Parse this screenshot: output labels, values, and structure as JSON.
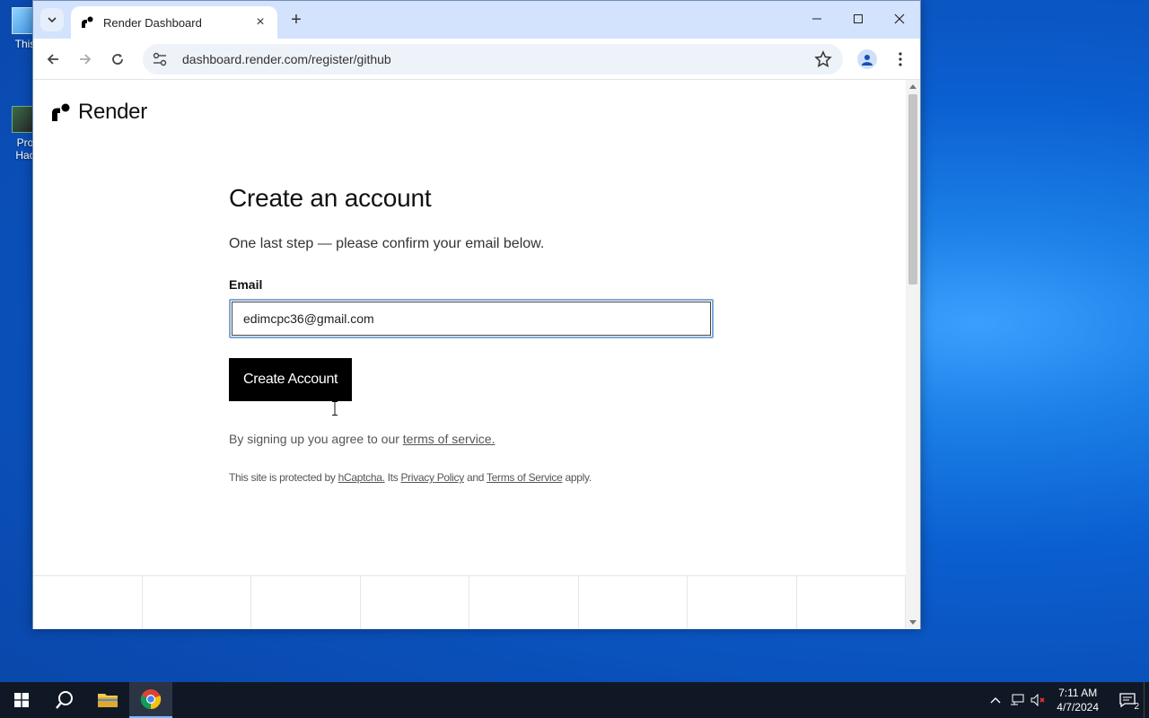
{
  "desktop": {
    "icons": [
      {
        "label": "This"
      },
      {
        "label": "Pro Hac"
      }
    ]
  },
  "browser": {
    "tab": {
      "title": "Render Dashboard"
    },
    "url": "dashboard.render.com/register/github"
  },
  "page": {
    "logo_text": "Render",
    "heading": "Create an account",
    "subtitle": "One last step — please confirm your email below.",
    "email_label": "Email",
    "email_value": "edimcpc36@gmail.com",
    "cta_label": "Create Account",
    "terms_prefix": "By signing up you agree to our ",
    "terms_link": "terms of service.",
    "captcha_prefix": "This site is protected by ",
    "captcha_link": "hCaptcha.",
    "captcha_mid": " Its ",
    "privacy_link": "Privacy Policy",
    "captcha_and": " and ",
    "tos_link": "Terms of Service",
    "captcha_suffix": " apply."
  },
  "taskbar": {
    "time": "7:11 AM",
    "date": "4/7/2024",
    "notification_count": "2"
  },
  "icons": {
    "start": "windows-start-icon",
    "search": "search-icon",
    "explorer": "folder-icon",
    "chrome": "chrome-icon"
  },
  "colors": {
    "cta_bg": "#000000",
    "input_focus": "#7ea8d6",
    "titlebar": "#d3e3fd"
  }
}
